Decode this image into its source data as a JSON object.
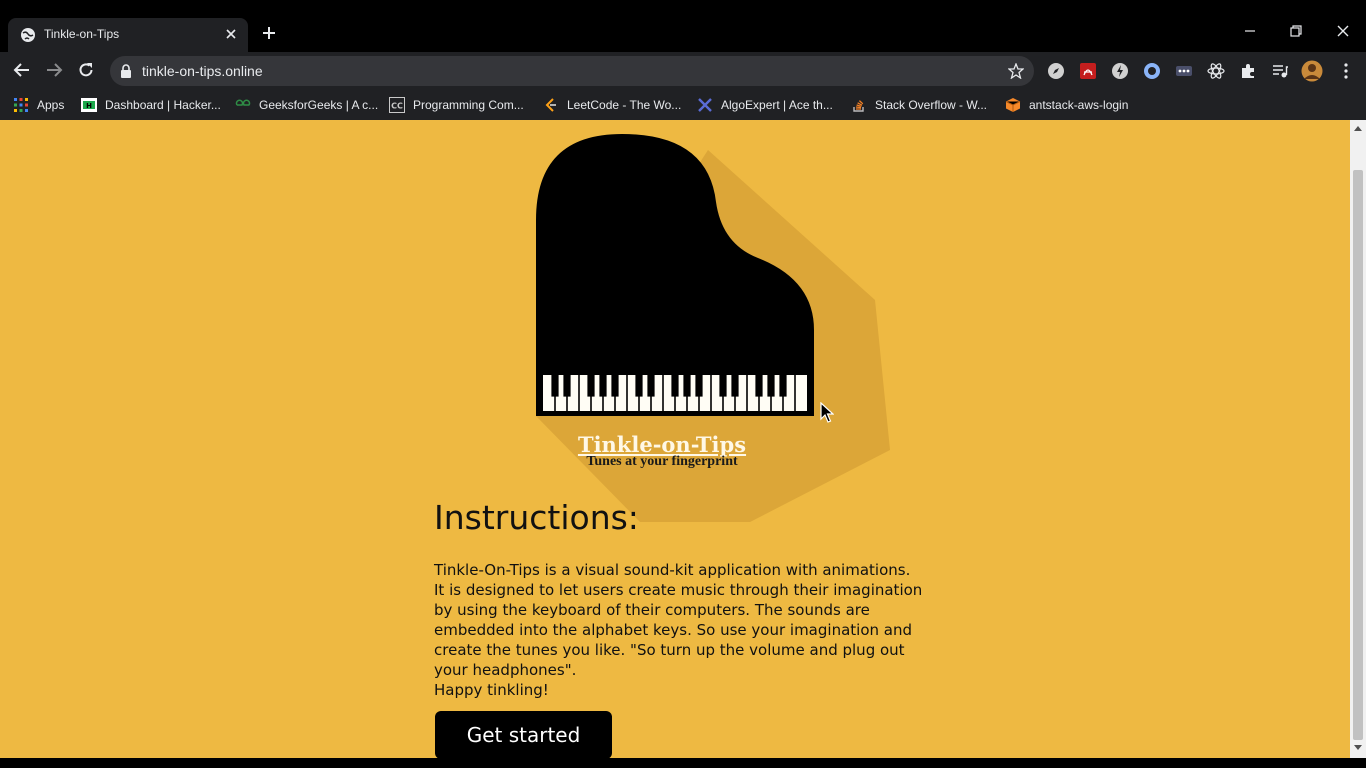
{
  "browser": {
    "tab": {
      "title": "Tinkle-on-Tips"
    },
    "address": {
      "url": "tinkle-on-tips.online"
    },
    "bookmarks": [
      {
        "label": "Apps",
        "icon": "apps-grid-icon"
      },
      {
        "label": "Dashboard | Hacker...",
        "icon": "hackerrank-icon"
      },
      {
        "label": "GeeksforGeeks | A c...",
        "icon": "geeksforgeeks-icon"
      },
      {
        "label": "Programming Com...",
        "icon": "codechef-icon"
      },
      {
        "label": "LeetCode - The Wo...",
        "icon": "leetcode-icon"
      },
      {
        "label": "AlgoExpert | Ace th...",
        "icon": "algoexpert-icon"
      },
      {
        "label": "Stack Overflow - W...",
        "icon": "stackoverflow-icon"
      },
      {
        "label": "antstack-aws-login",
        "icon": "aws-cube-icon"
      }
    ]
  },
  "brand": {
    "title": "Tinkle-on-Tips",
    "tagline": "Tunes at your fingerprint"
  },
  "instructions": {
    "heading": "Instructions:",
    "body": [
      "Tinkle-On-Tips is a visual sound-kit application with animations.",
      "It is designed to let users create music through their imagination",
      "by using the keyboard of their computers. The sounds are",
      "embedded into the alphabet keys. So use your imagination and",
      "create the tunes you like. \"So turn up the volume and plug out",
      "your headphones\".",
      "Happy tinkling!"
    ],
    "button_label": "Get started"
  },
  "colors": {
    "page_background": "#eeb942",
    "chrome_background": "#202124",
    "button_background": "#000000"
  }
}
